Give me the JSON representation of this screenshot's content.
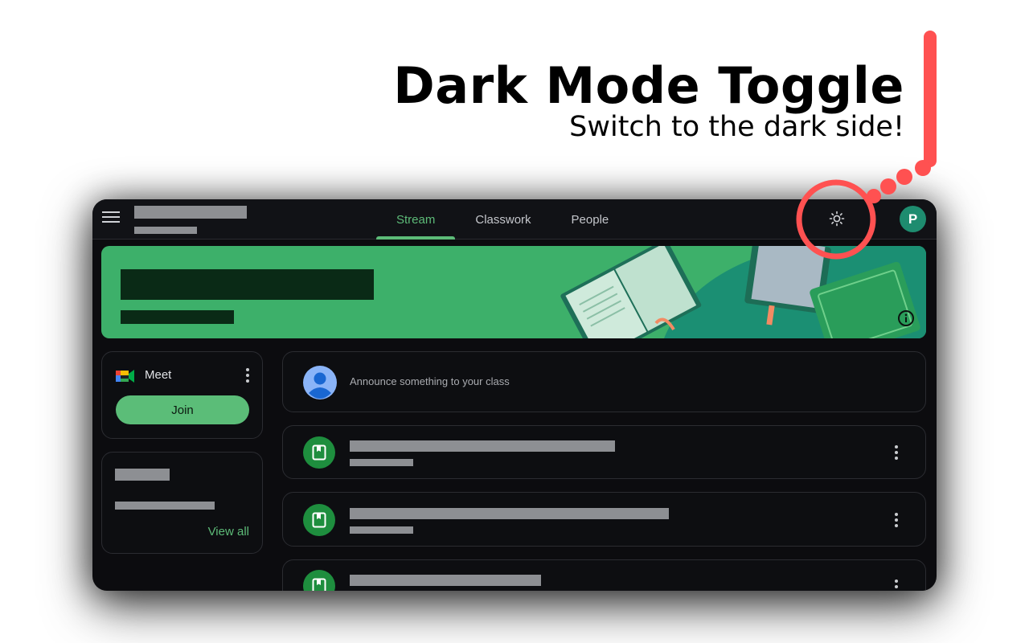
{
  "promo": {
    "title": "Dark Mode Toggle",
    "subtitle": "Switch to the dark side!",
    "accent_color": "#ff5151"
  },
  "header": {
    "class_name_redacted": true,
    "tabs": [
      {
        "label": "Stream",
        "active": true
      },
      {
        "label": "Classwork",
        "active": false
      },
      {
        "label": "People",
        "active": false
      }
    ],
    "theme_toggle_icon": "sun-icon",
    "more_icon": "more-vert-icon",
    "avatar_initial": "P",
    "avatar_color": "#1e8c6f"
  },
  "banner": {
    "color": "#3db06a",
    "info_icon": "info-icon"
  },
  "meet": {
    "label": "Meet",
    "join_label": "Join"
  },
  "upcoming": {
    "view_all_label": "View all"
  },
  "stream": {
    "announce_placeholder": "Announce something to your class",
    "posts": [
      {
        "icon": "assignment-icon"
      },
      {
        "icon": "assignment-icon"
      },
      {
        "icon": "assignment-icon"
      }
    ]
  },
  "colors": {
    "accent_green": "#5dbb78",
    "background": "#0c0c0f"
  }
}
